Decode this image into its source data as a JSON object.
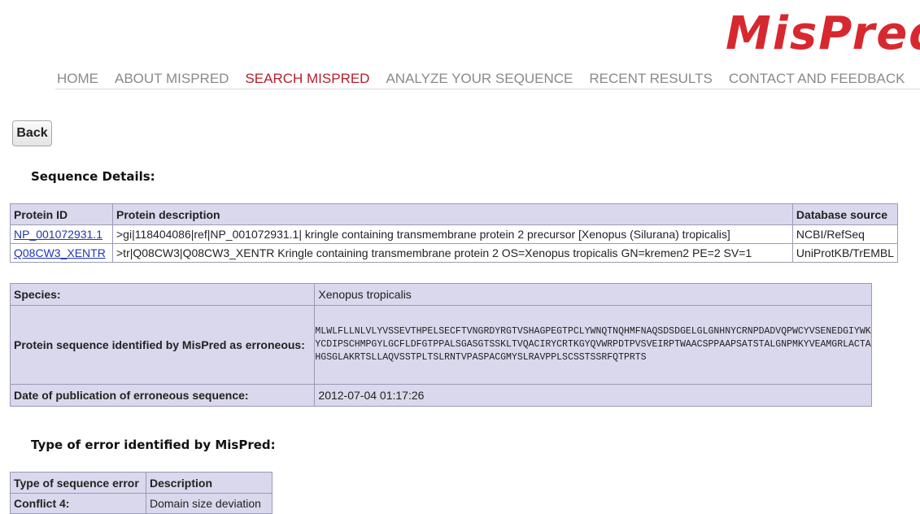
{
  "logo": "MisPred",
  "nav": {
    "items": [
      {
        "label": "HOME",
        "active": false
      },
      {
        "label": "ABOUT MISPRED",
        "active": false
      },
      {
        "label": "SEARCH MISPRED",
        "active": true
      },
      {
        "label": "ANALYZE YOUR SEQUENCE",
        "active": false
      },
      {
        "label": "RECENT RESULTS",
        "active": false
      },
      {
        "label": "CONTACT AND FEEDBACK",
        "active": false
      }
    ]
  },
  "back_label": "Back",
  "sequence_details": {
    "heading": "Sequence Details:",
    "columns": [
      "Protein ID",
      "Protein description",
      "Database source"
    ],
    "rows": [
      {
        "protein_id": "NP_001072931.1",
        "description": ">gi|118404086|ref|NP_001072931.1| kringle containing transmembrane protein 2 precursor [Xenopus (Silurana) tropicalis]",
        "source": "NCBI/RefSeq"
      },
      {
        "protein_id": "Q08CW3_XENTR",
        "description": ">tr|Q08CW3|Q08CW3_XENTR Kringle containing transmembrane protein 2 OS=Xenopus tropicalis GN=kremen2 PE=2 SV=1",
        "source": "UniProtKB/TrEMBL"
      }
    ]
  },
  "info": {
    "species_label": "Species:",
    "species_value": "Xenopus tropicalis",
    "sequence_label": "Protein sequence identified by MisPred as erroneous:",
    "sequence_value": "MLWLFLLNLVLYVSSEVTHPELSECFTVNGRDYRGTVSHAGPEGTPCLYWNQTNQHMFNAQSDSDGELGLGNHNYCRNPDADVQPWCYVSENEDGIYWKYCDIPSCHMPGYLGCFLDFGTPPALSGASGTSSKLTVQACIRYCRTKGYQVWRPDTPVSVEIRPTWAACSPPAAPSATSTALGNPMKYVEAMGRLACTAHGSGLAKRTSLLAQVSSTPLTSLRNTVPASPACGMYSLRAVPPLSCSSTSSRFQTPRTS",
    "date_label": "Date of publication of erroneous sequence:",
    "date_value": "2012-07-04 01:17:26"
  },
  "error_type": {
    "heading": "Type of error identified by MisPred:",
    "columns": [
      "Type of sequence error",
      "Description"
    ],
    "rows": [
      {
        "type": "Conflict 4:",
        "description": "Domain size deviation"
      }
    ]
  }
}
